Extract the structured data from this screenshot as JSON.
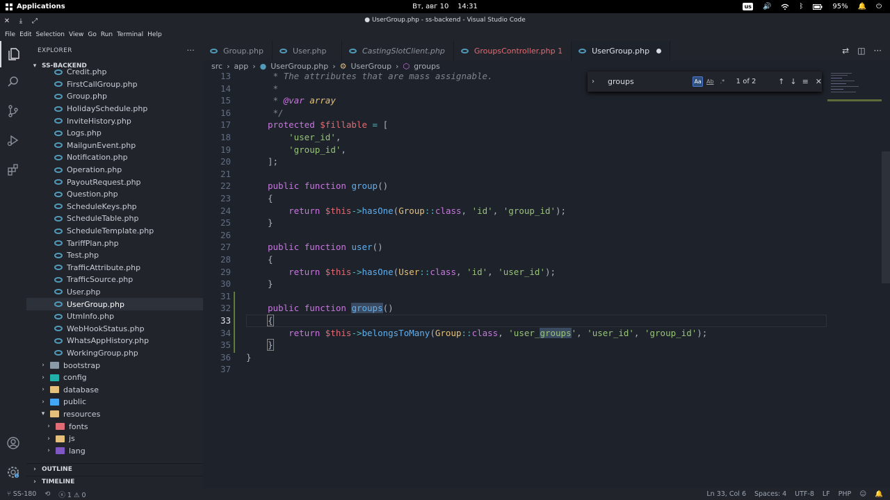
{
  "system": {
    "apps_label": "Applications",
    "date": "Вт, авг 10",
    "time": "14:31",
    "keyboard": "us",
    "battery": "95%"
  },
  "window": {
    "title": "● UserGroup.php - ss-backend - Visual Studio Code"
  },
  "menu": [
    "File",
    "Edit",
    "Selection",
    "View",
    "Go",
    "Run",
    "Terminal",
    "Help"
  ],
  "sidebar": {
    "header": "EXPLORER",
    "more": "···",
    "project": "SS-BACKEND",
    "files": [
      {
        "name": "Credit.php"
      },
      {
        "name": "FirstCallGroup.php"
      },
      {
        "name": "Group.php"
      },
      {
        "name": "HolidaySchedule.php"
      },
      {
        "name": "InviteHistory.php"
      },
      {
        "name": "Logs.php"
      },
      {
        "name": "MailgunEvent.php"
      },
      {
        "name": "Notification.php"
      },
      {
        "name": "Operation.php"
      },
      {
        "name": "PayoutRequest.php"
      },
      {
        "name": "Question.php"
      },
      {
        "name": "ScheduleKeys.php"
      },
      {
        "name": "ScheduleTable.php"
      },
      {
        "name": "ScheduleTemplate.php"
      },
      {
        "name": "TariffPlan.php"
      },
      {
        "name": "Test.php"
      },
      {
        "name": "TrafficAttribute.php"
      },
      {
        "name": "TrafficSource.php"
      },
      {
        "name": "User.php"
      },
      {
        "name": "UserGroup.php"
      },
      {
        "name": "UtmInfo.php"
      },
      {
        "name": "WebHookStatus.php"
      },
      {
        "name": "WhatsAppHistory.php"
      },
      {
        "name": "WorkingGroup.php"
      }
    ],
    "folders": [
      {
        "name": "bootstrap",
        "color": "#8b9aa8",
        "indent": 1,
        "open": false
      },
      {
        "name": "config",
        "color": "#20b2aa",
        "indent": 1,
        "open": false
      },
      {
        "name": "database",
        "color": "#e5c07b",
        "indent": 1,
        "open": false
      },
      {
        "name": "public",
        "color": "#42a5f5",
        "indent": 1,
        "open": false
      },
      {
        "name": "resources",
        "color": "#e5c07b",
        "indent": 1,
        "open": true
      },
      {
        "name": "fonts",
        "color": "#e06c75",
        "indent": 2,
        "open": false
      },
      {
        "name": "js",
        "color": "#e5c07b",
        "indent": 2,
        "open": false
      },
      {
        "name": "lang",
        "color": "#7e57c2",
        "indent": 2,
        "open": false
      }
    ],
    "outline": "OUTLINE",
    "timeline": "TIMELINE"
  },
  "tabs": [
    {
      "label": "Group.php",
      "italic": false,
      "error": false,
      "active": false
    },
    {
      "label": "User.php",
      "italic": false,
      "error": false,
      "active": false
    },
    {
      "label": "CastingSlotClient.php",
      "italic": true,
      "error": false,
      "active": false
    },
    {
      "label": "GroupsController.php 1",
      "italic": false,
      "error": true,
      "active": false
    },
    {
      "label": "UserGroup.php",
      "italic": false,
      "error": false,
      "active": true
    }
  ],
  "breadcrumbs": [
    "src",
    "app",
    "UserGroup.php",
    "UserGroup",
    "groups"
  ],
  "find": {
    "query": "groups",
    "opt_case": "Aa",
    "opt_word": "Ab",
    "opt_regex": ".*",
    "result": "1 of 2"
  },
  "code": {
    "current_line": 33,
    "lines": [
      {
        "n": "13",
        "html": "<span class='cm'> * The attributes that are mass assignable.</span>"
      },
      {
        "n": "14",
        "html": "<span class='cm'> *</span>"
      },
      {
        "n": "15",
        "html": "<span class='cm'> * </span><span class='kw' style='font-style:italic'>@var</span><span class='cl' style='font-style:italic'> array</span>"
      },
      {
        "n": "16",
        "html": "<span class='cm'> */</span>"
      },
      {
        "n": "17",
        "html": "<span class='kw'>protected</span> <span class='vr'>$fillable</span> <span class='op'>=</span> <span class='pl'>[</span>"
      },
      {
        "n": "18",
        "html": "    <span class='st'>'user_id'</span><span class='pl'>,</span>"
      },
      {
        "n": "19",
        "html": "    <span class='st'>'group_id'</span><span class='pl'>,</span>"
      },
      {
        "n": "20",
        "html": "<span class='pl'>];</span>"
      },
      {
        "n": "21",
        "html": ""
      },
      {
        "n": "22",
        "html": "<span class='kw'>public</span> <span class='kw'>function</span> <span class='fn'>group</span><span class='pl'>()</span>"
      },
      {
        "n": "23",
        "html": "<span class='pl'>{</span>"
      },
      {
        "n": "24",
        "html": "    <span class='kw'>return</span> <span class='vr'>$this</span><span class='op'>-></span><span class='fn'>hasOne</span><span class='pl'>(</span><span class='cl'>Group</span><span class='op'>::</span><span class='kw'>class</span><span class='pl'>, </span><span class='st'>'id'</span><span class='pl'>, </span><span class='st'>'group_id'</span><span class='pl'>);</span>"
      },
      {
        "n": "25",
        "html": "<span class='pl'>}</span>"
      },
      {
        "n": "26",
        "html": ""
      },
      {
        "n": "27",
        "html": "<span class='kw'>public</span> <span class='kw'>function</span> <span class='fn'>user</span><span class='pl'>()</span>"
      },
      {
        "n": "28",
        "html": "<span class='pl'>{</span>"
      },
      {
        "n": "29",
        "html": "    <span class='kw'>return</span> <span class='vr'>$this</span><span class='op'>-></span><span class='fn'>hasOne</span><span class='pl'>(</span><span class='cl'>User</span><span class='op'>::</span><span class='kw'>class</span><span class='pl'>, </span><span class='st'>'id'</span><span class='pl'>, </span><span class='st'>'user_id'</span><span class='pl'>);</span>"
      },
      {
        "n": "30",
        "html": "<span class='pl'>}</span>"
      },
      {
        "n": "31",
        "html": ""
      },
      {
        "n": "32",
        "html": "<span class='kw'>public</span> <span class='kw'>function</span> <span class='fn hl'>groups</span><span class='pl'>()</span>"
      },
      {
        "n": "33",
        "html": "<span class='pl' style='outline:1px solid #888'>{</span>"
      },
      {
        "n": "34",
        "html": "    <span class='kw'>return</span> <span class='vr'>$this</span><span class='op'>-></span><span class='fn'>belongsToMany</span><span class='pl'>(</span><span class='cl'>Group</span><span class='op'>::</span><span class='kw'>class</span><span class='pl'>, </span><span class='st'>'user_<span class=\"hl\">groups</span>'</span><span class='pl'>, </span><span class='st'>'user_id'</span><span class='pl'>, </span><span class='st'>'group_id'</span><span class='pl'>);</span>"
      },
      {
        "n": "35",
        "html": "<span class='pl' style='outline:1px solid #888'>}</span>"
      },
      {
        "n": "36",
        "html": "<span class='pl'>}</span>",
        "outdent": true
      },
      {
        "n": "37",
        "html": ""
      }
    ]
  },
  "status": {
    "branch": "SS-180",
    "errors": "1",
    "warnings": "0",
    "position": "Ln 33, Col 6",
    "spaces": "Spaces: 4",
    "encoding": "UTF-8",
    "eol": "LF",
    "language": "PHP"
  }
}
